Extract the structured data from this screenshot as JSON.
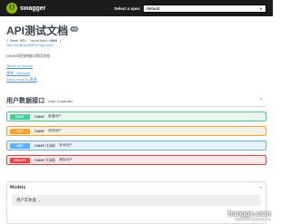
{
  "topbar": {
    "logo_glyph": "{}",
    "logo_text": "swagger",
    "spec_label": "Select a spec",
    "spec_value": "default",
    "colors": {
      "bg": "#1b1b1b",
      "logo": "#89bf04"
    }
  },
  "info": {
    "title": "API测试文档",
    "version": "1.0",
    "base_url": "[ Base URL: localhost:8080 ]",
    "api_docs_link": "http://localhost:8080/v2/api-docs",
    "description": "DEMO项目的接口测试文档",
    "terms_link": "Terms of service",
    "contact_link": "黄果 - Website",
    "email_link": "Send email to 黄果"
  },
  "tag": {
    "name": "用户数据接口",
    "description": "User Controller",
    "chevron_icon": "chevron-up-icon"
  },
  "operations": [
    {
      "method": "POST",
      "path": "/user",
      "summary": "新增用户",
      "color": "#49cc90"
    },
    {
      "method": "PUT",
      "path": "/user",
      "summary": "修改用户",
      "color": "#fca130"
    },
    {
      "method": "GET",
      "path": "/user/{id}",
      "summary": "查询用户",
      "color": "#61affe"
    },
    {
      "method": "DELETE",
      "path": "/user/{id}",
      "summary": "删除用户",
      "color": "#f93e3e"
    }
  ],
  "models": {
    "title": "Models",
    "items": [
      {
        "name": "用户实体类"
      }
    ]
  },
  "watermark": {
    "title": "hangge.com",
    "subtitle": "做最好的开发者知识平台"
  }
}
